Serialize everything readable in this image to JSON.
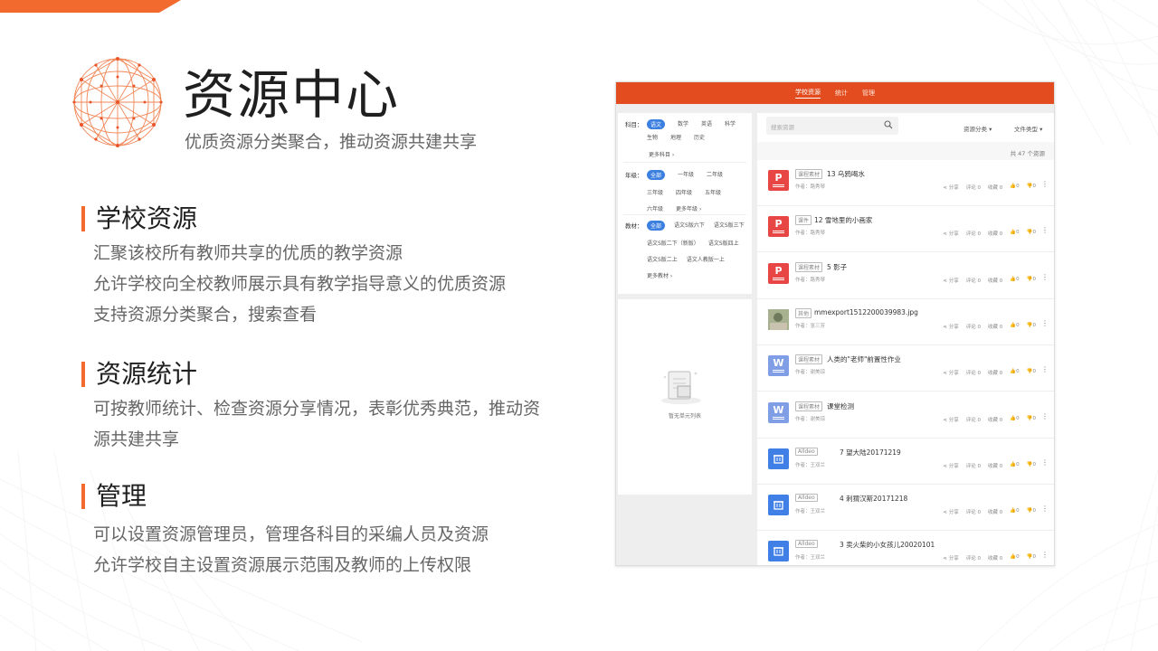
{
  "header": {
    "title": "资源中心",
    "subtitle": "优质资源分类聚合，推动资源共建共享"
  },
  "sections": [
    {
      "heading": "学校资源",
      "lines": [
        "汇聚该校所有教师共享的优质的教学资源",
        "允许学校向全校教师展示具有教学指导意义的优质资源",
        "支持资源分类聚合，搜索查看"
      ]
    },
    {
      "heading": "资源统计",
      "lines": [
        "可按教师统计、检查资源分享情况，表彰优秀典范，推动资",
        "源共建共享"
      ]
    },
    {
      "heading": "管理",
      "lines": [
        "可以设置资源管理员，管理各科目的采编人员及资源",
        "允许学校自主设置资源展示范围及教师的上传权限"
      ]
    }
  ],
  "colors": {
    "accent": "#f26a2e",
    "nav": "#e24c1e",
    "ppt": "#e84545",
    "word": "#7f9ee6",
    "alldeo": "#3f7fe6",
    "pill": "#3b7fe0"
  },
  "screenshot": {
    "nav": [
      "学校资源",
      "统计",
      "管理"
    ],
    "filters": {
      "subject_label": "科目：",
      "subjects": [
        "语文",
        "数学",
        "英语",
        "科学",
        "生物",
        "地理",
        "历史"
      ],
      "subject_more": "更多科目",
      "grade_label": "年级：",
      "grades": [
        "全部",
        "一年级",
        "二年级",
        "三年级",
        "四年级",
        "五年级",
        "六年级"
      ],
      "grade_more": "更多年级",
      "book_label": "教材：",
      "books": [
        "全部",
        "语文S版六下",
        "语文S版三下",
        "语文S版二下（新版）",
        "语文S版四上",
        "语文S版二上",
        "语文人教版一上"
      ],
      "book_more": "更多教材"
    },
    "empty_text": "暂无单元列表",
    "search_placeholder": "搜索资源",
    "dropdown_category": "资源分类",
    "dropdown_type": "文件类型",
    "total": "共 47 个资源",
    "stats_labels": {
      "share": "分享",
      "comment": "评论 0",
      "fav": "收藏 0",
      "like": "0",
      "dislike": "0"
    },
    "items": [
      {
        "tag": "课程素材",
        "name": "13 乌鸦喝水",
        "author": "作者：路秀琴",
        "icon": "P",
        "kind": "ppt"
      },
      {
        "tag": "课件",
        "name": "12 雪地里的小画家",
        "author": "作者：路秀琴",
        "icon": "P",
        "kind": "ppt"
      },
      {
        "tag": "课程素材",
        "name": "5 影子",
        "author": "作者：路秀琴",
        "icon": "P",
        "kind": "ppt"
      },
      {
        "tag": "其他",
        "name": "mmexport1512200039983.jpg",
        "author": "作者：张三芳",
        "icon": "",
        "kind": "img"
      },
      {
        "tag": "课程素材",
        "name": "人类的\"老师\"前置性作业",
        "author": "作者：谢美琼",
        "icon": "W",
        "kind": "word"
      },
      {
        "tag": "课程素材",
        "name": "课堂检测",
        "author": "作者：谢美琼",
        "icon": "W",
        "kind": "word"
      },
      {
        "tag": "Alldeo",
        "name": "7 望大陆20171219",
        "author": "作者：王双兰",
        "icon": "",
        "kind": "alldeo"
      },
      {
        "tag": "Alldeo",
        "name": "4 刺猬汉斯20171218",
        "author": "作者：王双兰",
        "icon": "",
        "kind": "alldeo"
      },
      {
        "tag": "Alldeo",
        "name": "3 卖火柴的小女孩儿20020101",
        "author": "作者：王双兰",
        "icon": "",
        "kind": "alldeo"
      }
    ]
  }
}
